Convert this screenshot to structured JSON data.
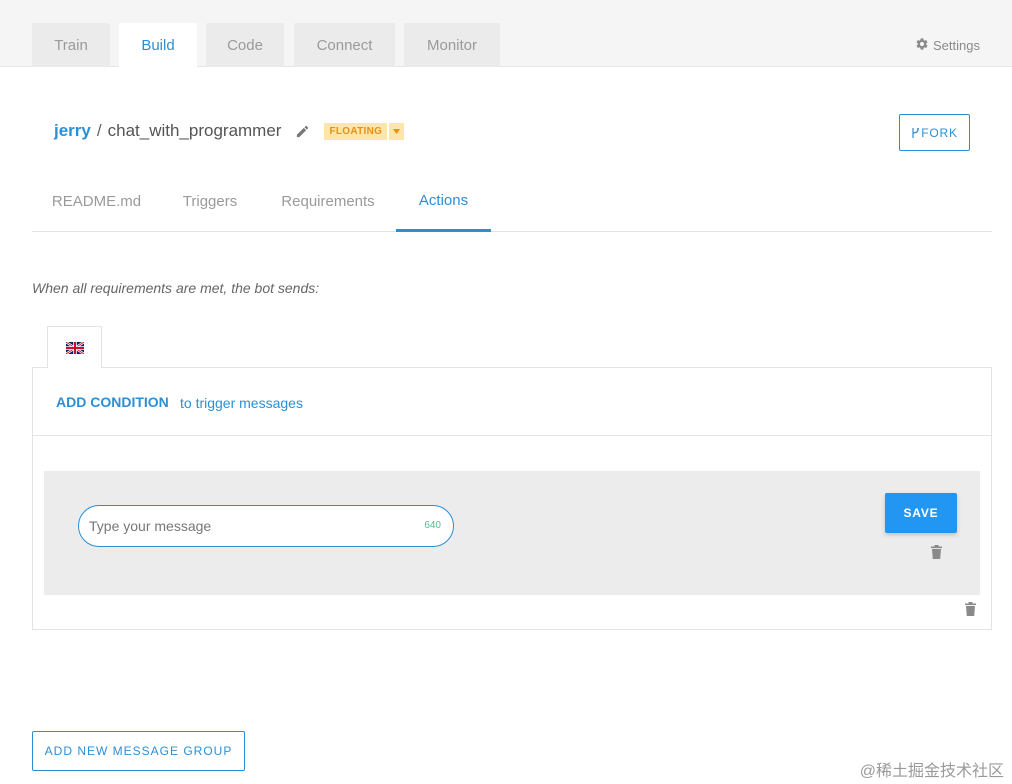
{
  "nav": {
    "tabs": [
      "Train",
      "Build",
      "Code",
      "Connect",
      "Monitor"
    ],
    "active_tab": "Build",
    "settings_label": "Settings"
  },
  "project": {
    "owner": "jerry",
    "separator": "/",
    "name": "chat_with_programmer",
    "badge": "FLOATING",
    "fork_label": "FORK"
  },
  "subtabs": {
    "items": [
      "README.md",
      "Triggers",
      "Requirements",
      "Actions"
    ],
    "active": "Actions"
  },
  "actions": {
    "intro": "When all requirements are met, the bot sends:",
    "language": "en-GB",
    "add_condition_label": "ADD CONDITION",
    "add_condition_hint": "to trigger messages",
    "message_placeholder": "Type your message",
    "char_counter": "640",
    "save_label": "SAVE",
    "add_group_label": "ADD NEW MESSAGE GROUP"
  },
  "watermark": "@稀土掘金技术社区",
  "colors": {
    "accent": "#2b8fd6",
    "save_button": "#2196f3",
    "badge_bg": "#fde6a8",
    "badge_text": "#e8901a",
    "counter": "#4fc08d"
  },
  "icons": [
    "gear-icon",
    "pencil-icon",
    "caret-down-icon",
    "fork-icon",
    "uk-flag-icon",
    "trash-icon"
  ]
}
